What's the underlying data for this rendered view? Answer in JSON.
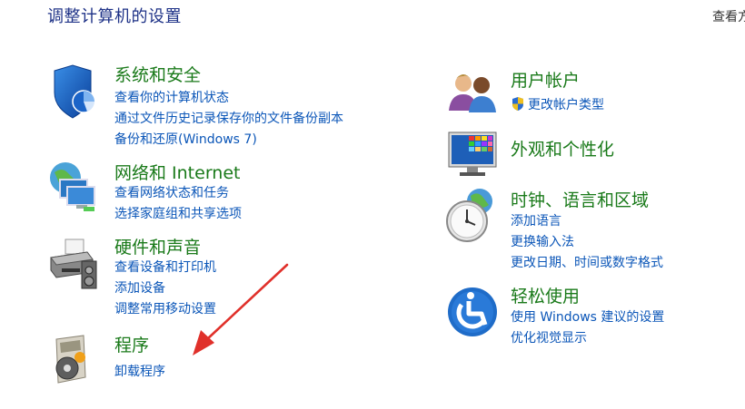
{
  "header": {
    "title": "调整计算机的设置",
    "view_by": "查看方"
  },
  "left": [
    {
      "title": "系统和安全",
      "icon": "shield-icon",
      "links": [
        "查看你的计算机状态",
        "通过文件历史记录保存你的文件备份副本",
        "备份和还原(Windows 7)"
      ]
    },
    {
      "title": "网络和 Internet",
      "icon": "network-globe-icon",
      "links": [
        "查看网络状态和任务",
        "选择家庭组和共享选项"
      ]
    },
    {
      "title": "硬件和声音",
      "icon": "printer-icon",
      "links": [
        "查看设备和打印机",
        "添加设备",
        "调整常用移动设置"
      ]
    },
    {
      "title": "程序",
      "icon": "programs-disc-icon",
      "links": [
        "卸载程序"
      ]
    }
  ],
  "right": [
    {
      "title": "用户帐户",
      "icon": "users-icon",
      "links": [
        "更改帐户类型"
      ]
    },
    {
      "title": "外观和个性化",
      "icon": "monitor-palette-icon",
      "links": []
    },
    {
      "title": "时钟、语言和区域",
      "icon": "clock-globe-icon",
      "links": [
        "添加语言",
        "更换输入法",
        "更改日期、时间或数字格式"
      ]
    },
    {
      "title": "轻松使用",
      "icon": "ease-of-access-icon",
      "links": [
        "使用 Windows 建议的设置",
        "优化视觉显示"
      ]
    }
  ],
  "colors": {
    "title_green": "#1a7a1a",
    "link_blue": "#0b56b8",
    "header_blue": "#1e3287",
    "annotation_red": "#e0302a"
  }
}
